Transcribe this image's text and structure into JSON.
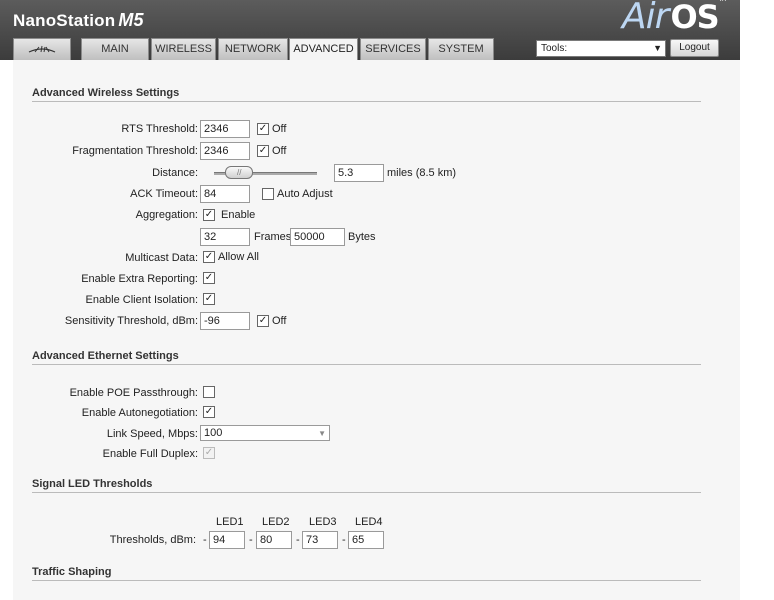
{
  "header": {
    "product_name": "NanoStation",
    "product_model": "M5",
    "os_logo_air": "Air",
    "os_logo_os": "OS",
    "os_logo_tm": "TM"
  },
  "tabs": [
    {
      "label": "MAIN"
    },
    {
      "label": "WIRELESS"
    },
    {
      "label": "NETWORK"
    },
    {
      "label": "ADVANCED"
    },
    {
      "label": "SERVICES"
    },
    {
      "label": "SYSTEM"
    }
  ],
  "tools": {
    "value": "Tools:"
  },
  "logout_label": "Logout",
  "wireless": {
    "title": "Advanced Wireless Settings",
    "rts": {
      "label": "RTS Threshold:",
      "value": "2346",
      "off_label": "Off",
      "off_checked": true
    },
    "frag": {
      "label": "Fragmentation Threshold:",
      "value": "2346",
      "off_label": "Off",
      "off_checked": true
    },
    "distance": {
      "label": "Distance:",
      "value": "5.3",
      "unit": "miles (8.5 km)",
      "slider_level": 0.15
    },
    "ack": {
      "label": "ACK Timeout:",
      "value": "84",
      "auto_label": "Auto Adjust",
      "auto_checked": false
    },
    "aggregation": {
      "label": "Aggregation:",
      "enable_label": "Enable",
      "enable_checked": true,
      "frames_value": "32",
      "frames_label": "Frames",
      "bytes_value": "50000",
      "bytes_label": "Bytes"
    },
    "multicast": {
      "label": "Multicast Data:",
      "allow_label": "Allow All",
      "checked": true
    },
    "extra_reporting": {
      "label": "Enable Extra Reporting:",
      "checked": true
    },
    "client_isolation": {
      "label": "Enable Client Isolation:",
      "checked": true
    },
    "sensitivity": {
      "label": "Sensitivity Threshold, dBm:",
      "value": "-96",
      "off_label": "Off",
      "off_checked": true
    }
  },
  "ethernet": {
    "title": "Advanced Ethernet Settings",
    "poe": {
      "label": "Enable POE Passthrough:",
      "checked": false
    },
    "autoneg": {
      "label": "Enable Autonegotiation:",
      "checked": true
    },
    "link_speed": {
      "label": "Link Speed, Mbps:",
      "value": "100"
    },
    "full_duplex": {
      "label": "Enable Full Duplex:",
      "checked": true
    }
  },
  "led": {
    "title": "Signal LED Thresholds",
    "thresholds_label": "Thresholds, dBm:",
    "headers": [
      "LED1",
      "LED2",
      "LED3",
      "LED4"
    ],
    "values": [
      "94",
      "80",
      "73",
      "65"
    ],
    "dash": "-"
  },
  "traffic": {
    "title": "Traffic Shaping"
  },
  "icons": {
    "brand_logo": "ubiquiti-logo-icon",
    "dropdown_arrow": "chevron-down-icon",
    "check": "✓"
  }
}
